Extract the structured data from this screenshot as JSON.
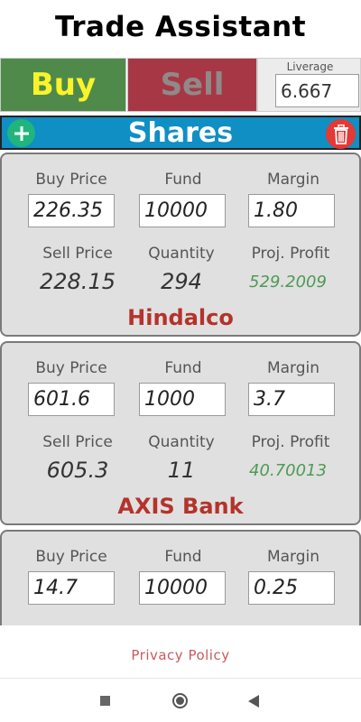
{
  "app_title": "Trade Assistant",
  "buttons": {
    "buy": "Buy",
    "sell": "Sell",
    "add": "+",
    "delete": "delete"
  },
  "leverage": {
    "label": "Liverage",
    "value": "6.667"
  },
  "section_title": "Shares",
  "labels": {
    "buy_price": "Buy Price",
    "fund": "Fund",
    "margin": "Margin",
    "sell_price": "Sell Price",
    "quantity": "Quantity",
    "proj_profit": "Proj. Profit"
  },
  "shares": [
    {
      "buy_price": "226.35",
      "fund": "10000",
      "margin": "1.80",
      "sell_price": "228.15",
      "quantity": "294",
      "proj_profit": "529.2009",
      "name": "Hindalco"
    },
    {
      "buy_price": "601.6",
      "fund": "1000",
      "margin": "3.7",
      "sell_price": "605.3",
      "quantity": "11",
      "proj_profit": "40.70013",
      "name": "AXIS Bank"
    },
    {
      "buy_price": "14.7",
      "fund": "10000",
      "margin": "0.25"
    }
  ],
  "footer": {
    "privacy": "Privacy Policy"
  },
  "colors": {
    "buy": "#4f8a4b",
    "sell": "#a83745",
    "shares_bar": "#0f8fc4",
    "add": "#1fb57d",
    "delete": "#e53935",
    "profit": "#4e9a55",
    "name": "#b4332b"
  }
}
